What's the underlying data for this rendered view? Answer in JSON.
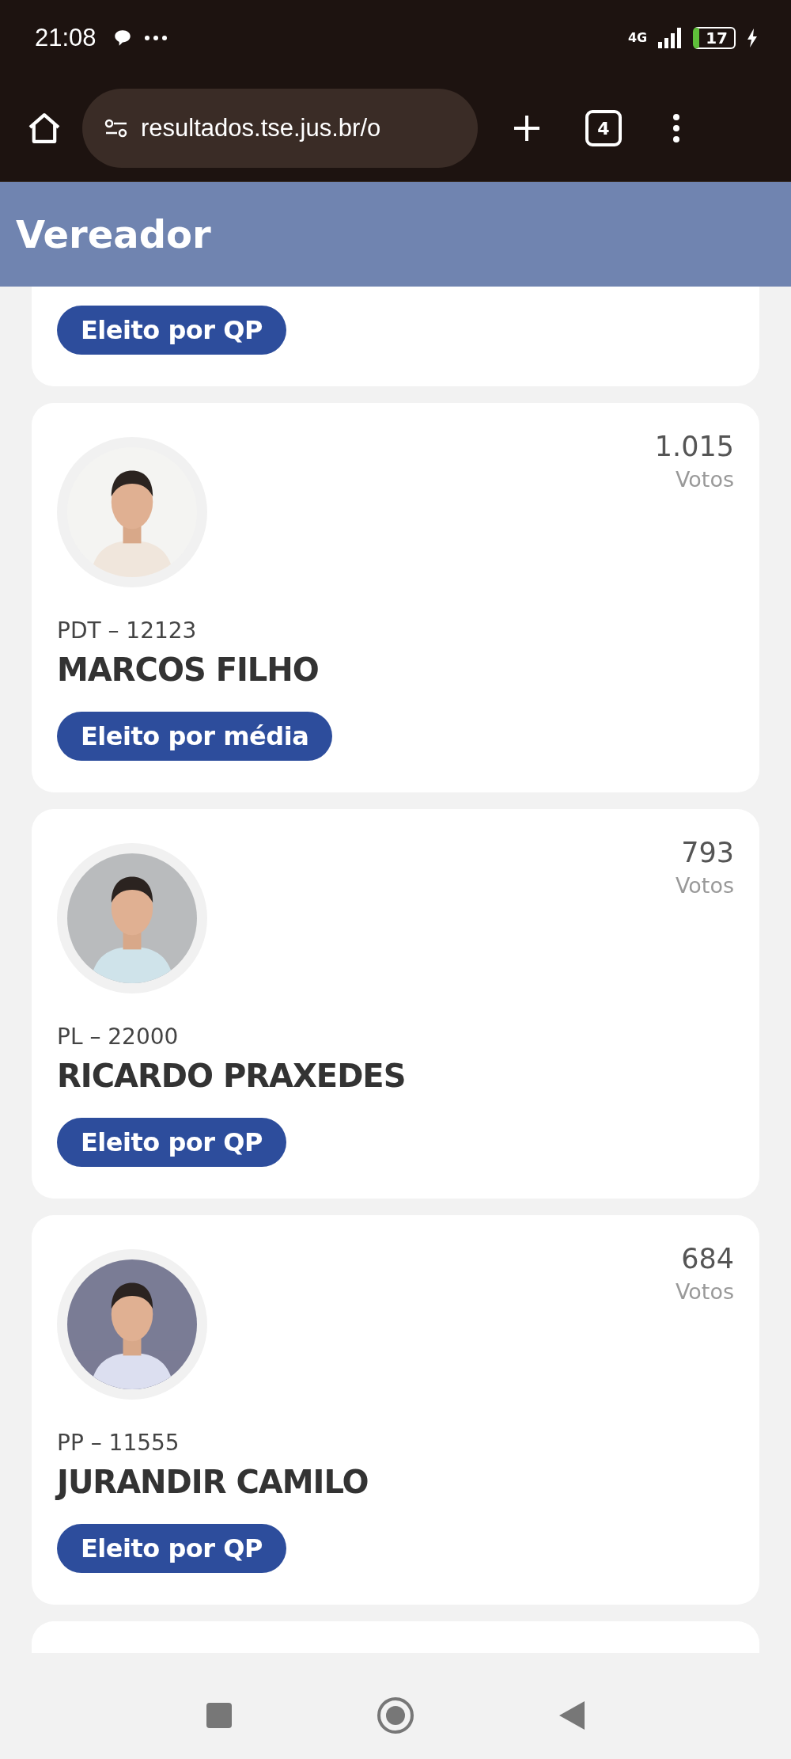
{
  "status_bar": {
    "time": "21:08",
    "network": "4G",
    "battery": "17"
  },
  "browser": {
    "url": "resultados.tse.jus.br/o",
    "tab_count": "4"
  },
  "header": {
    "title": "Vereador"
  },
  "candidates": [
    {
      "kind": "cut",
      "result": "Eleito por QP"
    },
    {
      "kind": "full",
      "votes": "1.015",
      "votes_label": "Votos",
      "party": "PDT – 12123",
      "name": "MARCOS FILHO",
      "result": "Eleito por média"
    },
    {
      "kind": "full",
      "votes": "793",
      "votes_label": "Votos",
      "party": "PL – 22000",
      "name": "RICARDO PRAXEDES",
      "result": "Eleito por QP"
    },
    {
      "kind": "full",
      "votes": "684",
      "votes_label": "Votos",
      "party": "PP – 11555",
      "name": "JURANDIR CAMILO",
      "result": "Eleito por QP"
    },
    {
      "kind": "edge"
    }
  ]
}
